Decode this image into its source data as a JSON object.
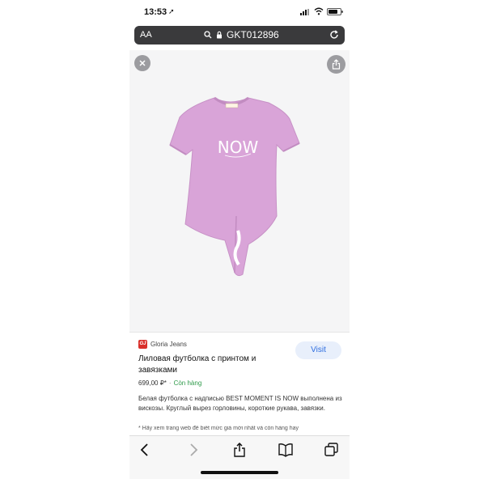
{
  "status_bar": {
    "time": "13:53",
    "location_arrow": "➚"
  },
  "address_bar": {
    "text_size_label": "AA",
    "url": "GKT012896"
  },
  "icons": {
    "close": "close-icon",
    "share": "share-icon",
    "lock": "lock-icon",
    "search": "search-icon",
    "reload": "reload-icon",
    "back": "chevron-left-icon",
    "forward": "chevron-right-icon",
    "bookmarks": "book-icon",
    "tabs": "tabs-icon"
  },
  "product": {
    "image_print_text": "NOW",
    "brand_logo_text": "GJ",
    "brand_name": "Gloria Jeans",
    "title": "Лиловая футболка с принтом и завязками",
    "price": "699,00 ₽*",
    "stock_status": "Còn hàng",
    "description": "Белая футболка с надписью BEST MOMENT IS NOW выполнена из вискозы. Круглый вырез горловины, короткие рукава, завязки.",
    "note": "* Hãy xem trang web để biết mức giá mới nhất và còn hàng hay"
  },
  "buttons": {
    "visit": "Visit"
  },
  "colors": {
    "shirt": "#d9a4d8",
    "visit_bg": "#e8effb",
    "visit_text": "#2f6ee0",
    "stock_green": "#2e9a4a",
    "address_bar_bg": "#3a3a3c",
    "brand_red": "#d9302b"
  }
}
